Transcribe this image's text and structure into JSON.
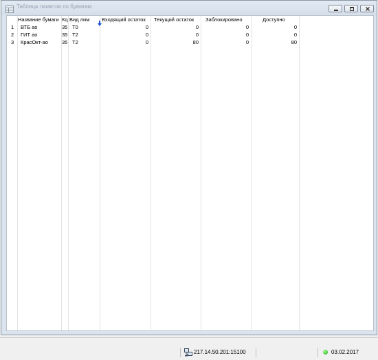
{
  "window": {
    "title": "Таблица лимитов по бумагам"
  },
  "table": {
    "columns": [
      {
        "label": ""
      },
      {
        "label": "Название бумаги"
      },
      {
        "label": "Код"
      },
      {
        "label": "Вид лим"
      },
      {
        "label": "Входящий остаток"
      },
      {
        "label": "Текущий остаток"
      },
      {
        "label": "Заблокировано"
      },
      {
        "label": "Доступно"
      }
    ],
    "sort_icon": "arrow-down-icon",
    "rows": [
      {
        "n": "1",
        "name": "ВТБ ао",
        "code": "35",
        "limit_type": "T0",
        "incoming": "0",
        "current": "0",
        "blocked": "0",
        "available": "0"
      },
      {
        "n": "2",
        "name": "ГИТ ао",
        "code": "35",
        "limit_type": "T2",
        "incoming": "0",
        "current": "0",
        "blocked": "0",
        "available": "0"
      },
      {
        "n": "3",
        "name": "КрасОкт-ао",
        "code": "35",
        "limit_type": "T2",
        "incoming": "0",
        "current": "80",
        "blocked": "0",
        "available": "80"
      }
    ]
  },
  "statusbar": {
    "server": "217.14.50.201:15100",
    "date": "03.02.2017",
    "status_color": "#1fa51a"
  }
}
